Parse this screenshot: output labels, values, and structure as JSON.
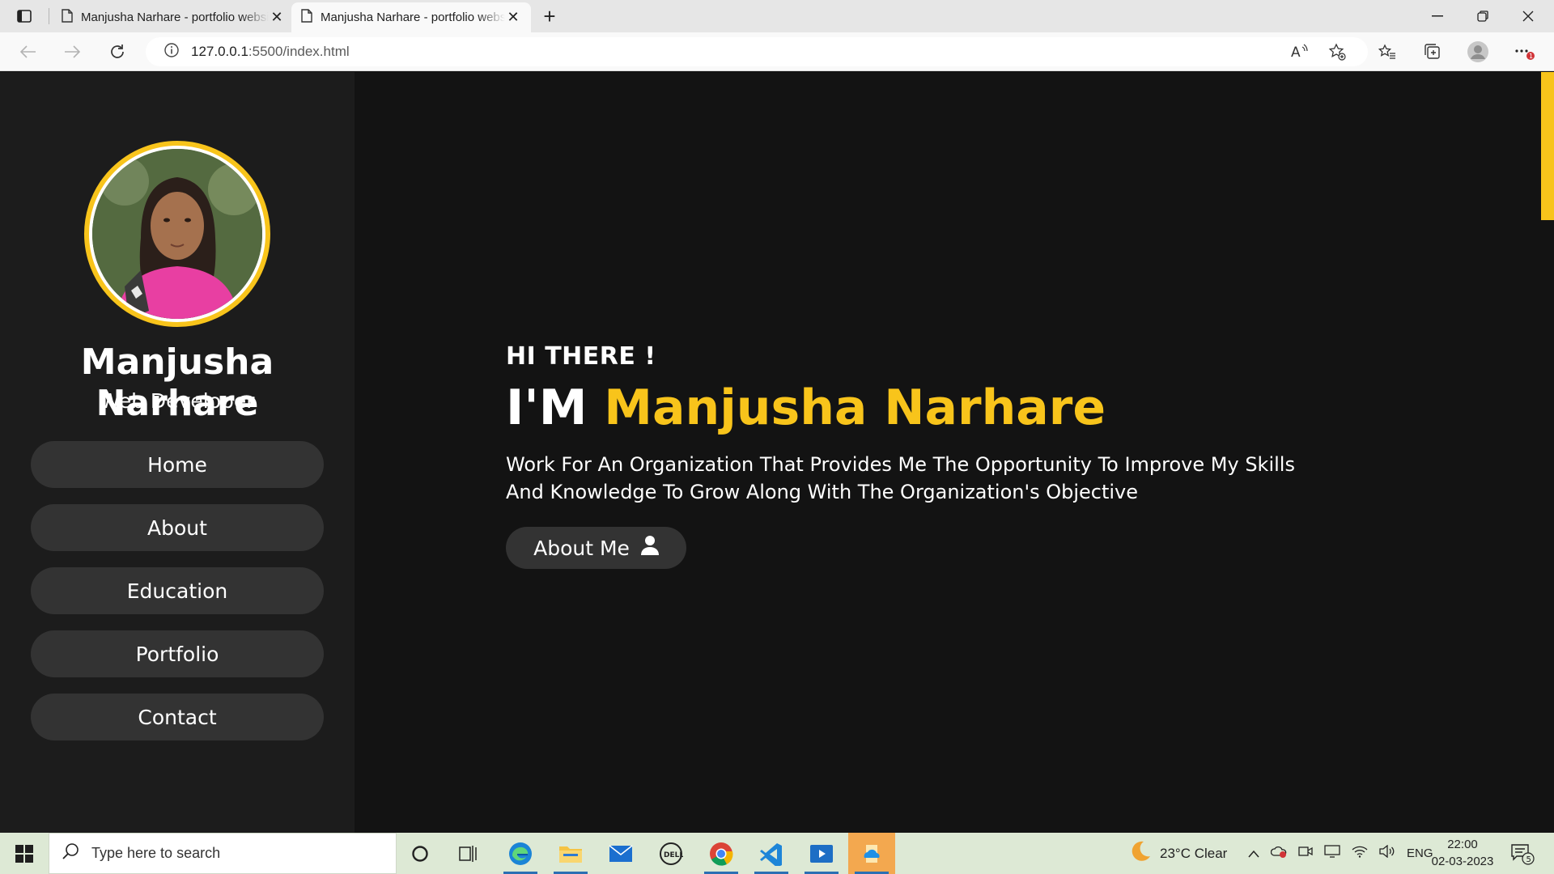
{
  "browser": {
    "tabs": [
      {
        "title": "Manjusha Narhare - portfolio website",
        "active": false
      },
      {
        "title": "Manjusha Narhare - portfolio website",
        "active": true
      }
    ],
    "url_host": "127.0.0.1",
    "url_rest": ":5500/index.html"
  },
  "sidebar": {
    "name": "Manjusha Narhare",
    "role": "Web Developer",
    "nav": [
      "Home",
      "About",
      "Education",
      "Portfolio",
      "Contact"
    ]
  },
  "hero": {
    "greeting": "HI THERE !",
    "title_prefix": "I'M ",
    "title_highlight": "Manjusha Narhare",
    "description": "Work For An Organization That Provides Me The Opportunity To Improve My Skills And Knowledge To Grow Along With The Organization's Objective",
    "button_label": "About Me"
  },
  "theme": {
    "accent": "#f8c41b",
    "background": "#131313",
    "sidebar": "#1c1c1c",
    "pill": "#333333"
  },
  "taskbar": {
    "search_placeholder": "Type here to search",
    "weather": "23°C  Clear",
    "language": "ENG",
    "time": "22:00",
    "date": "02-03-2023",
    "notification_count": "5"
  },
  "icons": [
    "sidebar-toggle-icon",
    "page-icon",
    "close-icon",
    "plus-icon",
    "minimize-icon",
    "restore-icon",
    "back-arrow-icon",
    "forward-arrow-icon",
    "refresh-icon",
    "info-icon",
    "read-aloud-icon",
    "add-favorite-icon",
    "favorites-icon",
    "collections-icon",
    "profile-icon",
    "more-icon",
    "user-icon",
    "windows-icon",
    "search-icon",
    "cortana-icon",
    "task-view-icon",
    "edge-icon",
    "file-explorer-icon",
    "mail-icon",
    "dell-icon",
    "chrome-icon",
    "vscode-icon",
    "media-player-icon",
    "onedrive-icon",
    "weather-icon",
    "chevron-up-icon",
    "network-icon",
    "speaker-icon",
    "notification-icon"
  ]
}
